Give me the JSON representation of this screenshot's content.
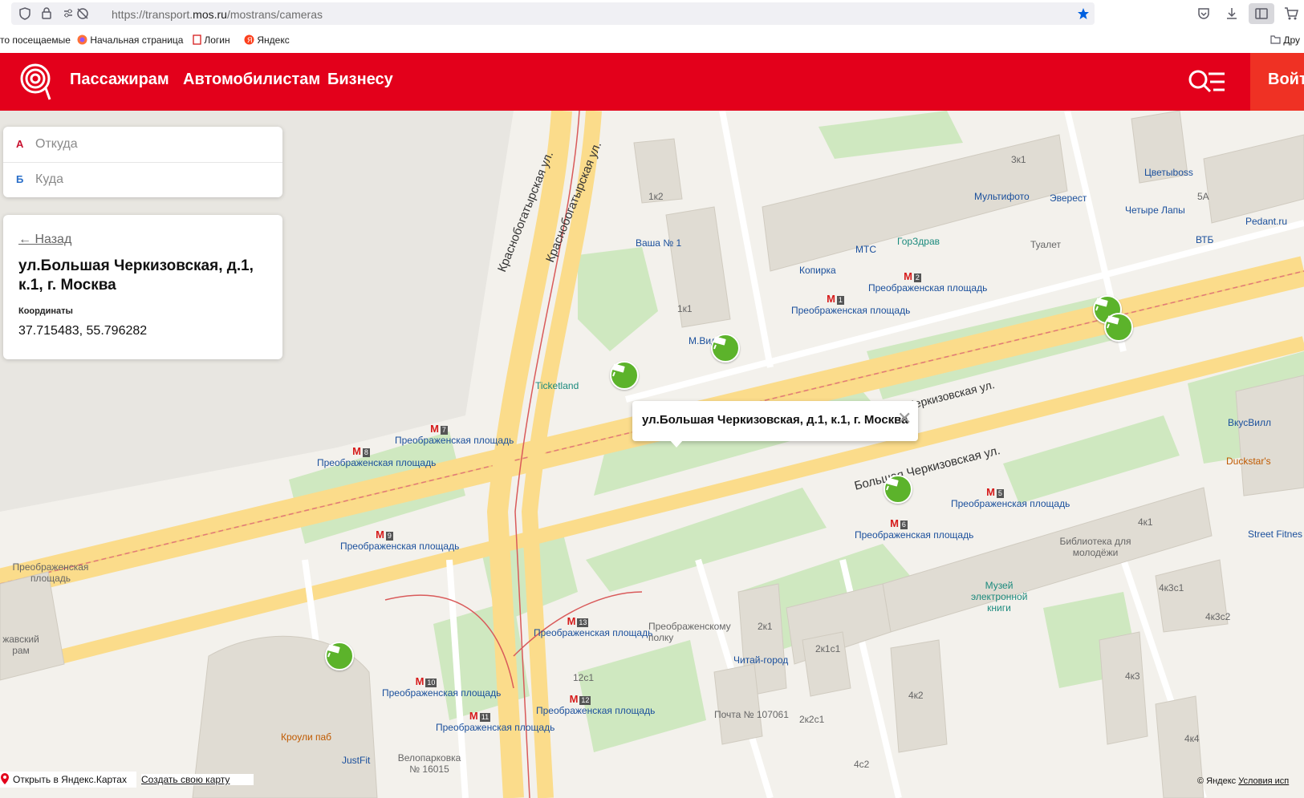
{
  "browser": {
    "url_prefix": "https://transport.",
    "url_domain": "mos.ru",
    "url_path": "/mostrans/cameras",
    "bookmarks": [
      "то посещаемые",
      "Начальная страница",
      "Логин",
      "Яндекс",
      "Дру"
    ]
  },
  "header": {
    "nav": [
      "Пассажирам",
      "Автомобилистам",
      "Бизнесу"
    ],
    "login_label": "Войт"
  },
  "route": {
    "from_letter": "А",
    "from_placeholder": "Откуда",
    "to_letter": "Б",
    "to_placeholder": "Куда"
  },
  "info": {
    "back_label": "← Назад",
    "address": "ул.Большая Черкизовская, д.1, к.1, г. Москва",
    "coords_label": "Координаты",
    "coords_value": "37.715483, 55.796282"
  },
  "popup": {
    "text": "ул.Большая Черкизовская, д.1, к.1, г. Москва",
    "close": "✕"
  },
  "map": {
    "streets": [
      "Краснобогатырская ул.",
      "Краснобогатырская ул.",
      "Большая Черкизовская ул.",
      "Большая Черкизовская ул."
    ],
    "metro": [
      {
        "name": "Преображенская площадь",
        "num": "1"
      },
      {
        "name": "Преображенская площадь",
        "num": "2"
      },
      {
        "name": "Преображенская площадь",
        "num": "5"
      },
      {
        "name": "Преображенская площадь",
        "num": "6"
      },
      {
        "name": "Преображенская площадь",
        "num": "7"
      },
      {
        "name": "Преображенская площадь",
        "num": "8"
      },
      {
        "name": "Преображенская площадь",
        "num": "9"
      },
      {
        "name": "Преображенская площадь",
        "num": "10"
      },
      {
        "name": "Преображенская площадь",
        "num": "11"
      },
      {
        "name": "Преображенская площадь",
        "num": "12"
      },
      {
        "name": "Преображенская площадь",
        "num": "13"
      }
    ],
    "pois": [
      "Ваша № 1",
      "М.Вид",
      "Ticketland",
      "МТС",
      "Копирка",
      "ГорЗдрав",
      "Мультифото",
      "Эверест",
      "Туалет",
      "Цветыboss",
      "Четыре Лапы",
      "Pedant.ru",
      "ВТБ",
      "ВкусВилл",
      "Duckstar's",
      "Street Fitnes",
      "Библиотека для молодёжи",
      "Музей электронной книги",
      "Читай-город",
      "Почта № 107061",
      "Кроули паб",
      "JustFit",
      "Велопарковка № 16015",
      "Преображенскому полку",
      "Преображенская площадь",
      "жавский рам"
    ],
    "buildings": [
      "1к2",
      "1к1",
      "3к1",
      "5А",
      "4к1",
      "4к3с1",
      "4к3с2",
      "2к1",
      "2к1с1",
      "2к2с1",
      "4к2",
      "4к3",
      "4к4",
      "4с2",
      "12с1"
    ],
    "bottom_open": "Открыть в Яндекс.Картах",
    "bottom_create": "Создать свою карту",
    "copyright": "© Яндекс",
    "terms": "Условия исп"
  },
  "colors": {
    "brand_red": "#e3001b",
    "camera_green": "#5cb32b",
    "metro_red": "#d61b1b"
  }
}
